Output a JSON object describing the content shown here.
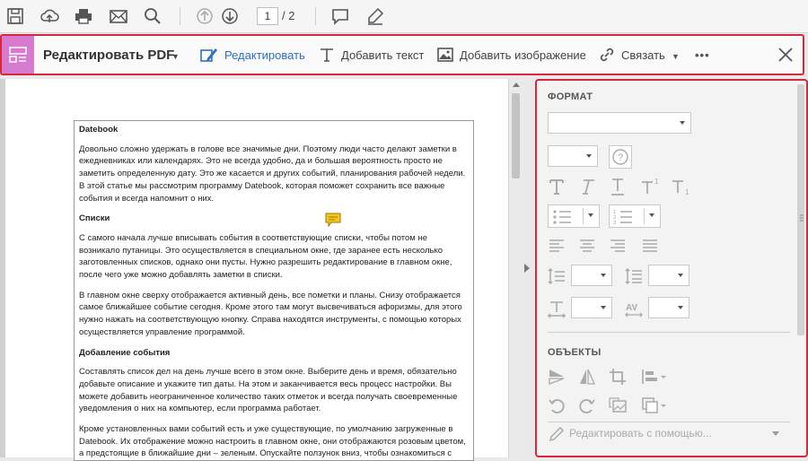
{
  "toolbar": {
    "icons": [
      "save-icon",
      "upload-icon",
      "print-icon",
      "mail-icon",
      "search-icon",
      "page-up-icon",
      "page-down-icon",
      "comment-icon",
      "highlight-pen-icon"
    ],
    "page_current": "1",
    "page_total": "/ 2"
  },
  "editbar": {
    "title": "Редактировать PDF",
    "edit_label": "Редактировать",
    "add_text_label": "Добавить текст",
    "add_image_label": "Добавить изображение",
    "link_label": "Связать",
    "more_label": "•••",
    "accent": "#d7263d",
    "active_color": "#2d6fc7"
  },
  "document": {
    "paragraphs": [
      {
        "text": "Datebook",
        "heading": true
      },
      {
        "text": "Довольно сложно удержать в голове все значимые дни. Поэтому люди часто делают заметки в ежедневниках или календарях. Это не всегда удобно, да и большая вероятность просто не заметить определенную дату. Это же касается и других событий, планирования рабочей недели. В этой статье мы рассмотрим программу Datebook, которая поможет сохранить все важные события и всегда напомнит о них."
      },
      {
        "text": "Списки",
        "heading": true
      },
      {
        "text": "С самого начала лучше вписывать события в соответствующие списки, чтобы потом не возникало путаницы. Это осуществляется в специальном окне, где заранее есть несколько заготовленных списков, однако они пусты. Нужно разрешить редактирование в главном окне, после чего уже можно добавлять заметки в списки."
      },
      {
        "text": "В главном окне сверху отображается активный день, все пометки и планы. Снизу отображается самое ближайшее событие сегодня. Кроме этого там могут высвечиваться афоризмы, для этого нужно нажать на соответствующую кнопку.  Справа находятся инструменты, с помощью которых осуществляется управление программой."
      },
      {
        "text": "Добавление события",
        "heading": true
      },
      {
        "text": "Составлять список дел на день лучше всего в этом окне. Выберите день и время, обязательно добавьте описание и укажите тип даты. На этом и заканчивается весь процесс настройки. Вы можете добавить неограниченное количество таких отметок и всегда получать своевременные уведомления о них на компьютер, если программа работает."
      },
      {
        "text": "Кроме установленных вами событий есть и уже существующие, по умолчанию загруженные в Datebook. Их отображение можно настроить в главном окне, они отображаются розовым цветом, а предстоящие в ближайшие дни – зеленым. Опускайте ползунок вниз, чтобы ознакомиться с полным списком."
      }
    ]
  },
  "panel": {
    "format_title": "ФОРМАТ",
    "objects_title": "ОБЪЕКТЫ",
    "edit_with_label": "Редактировать с помощью...",
    "format_icons": [
      "text-serif-icon",
      "text-italic-icon",
      "text-underline-icon",
      "text-superscript-icon",
      "text-subscript-icon",
      "bullet-list-icon",
      "numbered-list-icon",
      "align-left-icon",
      "align-center-icon",
      "align-right-icon",
      "align-justify-icon",
      "line-spacing-icon",
      "paragraph-spacing-icon",
      "text-scale-icon",
      "char-spacing-icon"
    ],
    "object_icons": [
      "flip-vertical-icon",
      "flip-horizontal-icon",
      "crop-icon",
      "align-objects-icon",
      "rotate-left-icon",
      "rotate-right-icon",
      "replace-image-icon",
      "arrange-icon"
    ]
  }
}
